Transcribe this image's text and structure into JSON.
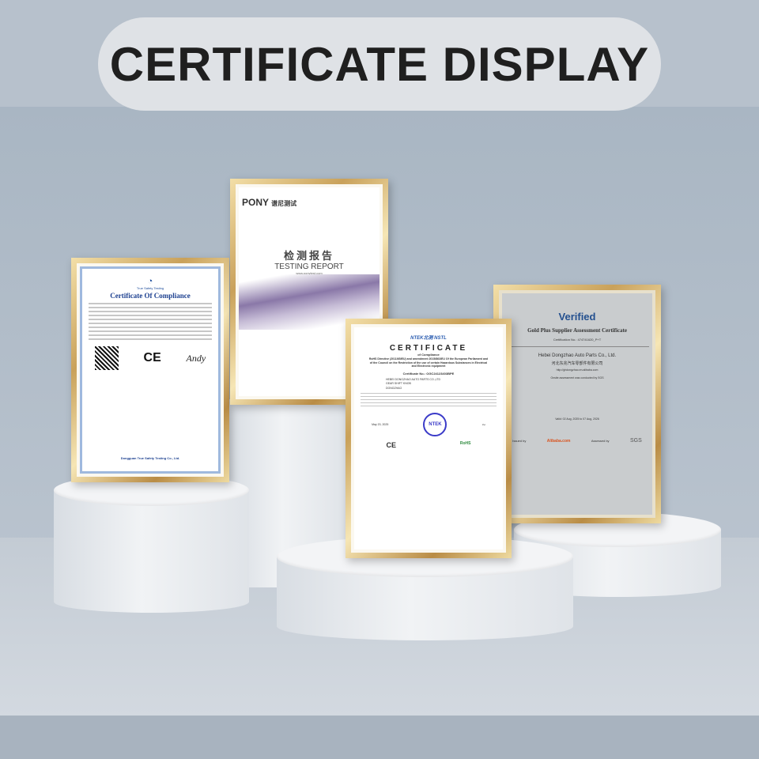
{
  "header": {
    "title": "CERTIFICATE DISPLAY"
  },
  "certificates": [
    {
      "issuer": "True Safety Testing",
      "title": "Certificate Of Compliance",
      "signature": "Andy",
      "mark": "CE",
      "footer": "Dongguan True Safety Testing Co., Ltd."
    },
    {
      "brand": "PONY",
      "brand_cn": "谱尼测试",
      "title_cn": "检测报告",
      "title": "TESTING REPORT",
      "url": "www.ponytest.com"
    },
    {
      "brand": "NTEK北测 NSTL",
      "title": "CERTIFICATE",
      "subtitle": "of Compliance",
      "directive": "RoHS Directive (2011/65/EU) and amendment 2015/863/EU Of the European Parliament and of the Council on the Restriction of the use of certain Hazardous Substances in Electrical and Electronic equipment",
      "cert_no": "Certificate No.: OGC24123403BPE",
      "applicant": "HEBEI DONGZHAO AUTO PARTS CO.,LTD",
      "product": "GEAR SHIFT KNOB",
      "trade_name": "DONGZHAO",
      "date": "May 20, 2025",
      "seal": "NTEK",
      "mark": "CE",
      "rohs": "RoHS"
    },
    {
      "logo": "Verified",
      "title": "Gold Plus Supplier Assessment Certificate",
      "cert_no": "Certification No.: 474741620_P+T",
      "company": "Hebei Dongzhao Auto Parts Co., Ltd.",
      "company_cn": "河北东兆汽车零部件有限公司",
      "url": "http://ghdongzhao.en.alibaba.com",
      "note": "Onsite assessment was conducted by SGS",
      "valid": "Valid: 02 Aug, 2025 to 07 Aug, 2026",
      "issued_by": "Issued by",
      "issuer": "Alibaba.com",
      "assessed_by": "Assessed by",
      "assessor": "SGS"
    }
  ]
}
